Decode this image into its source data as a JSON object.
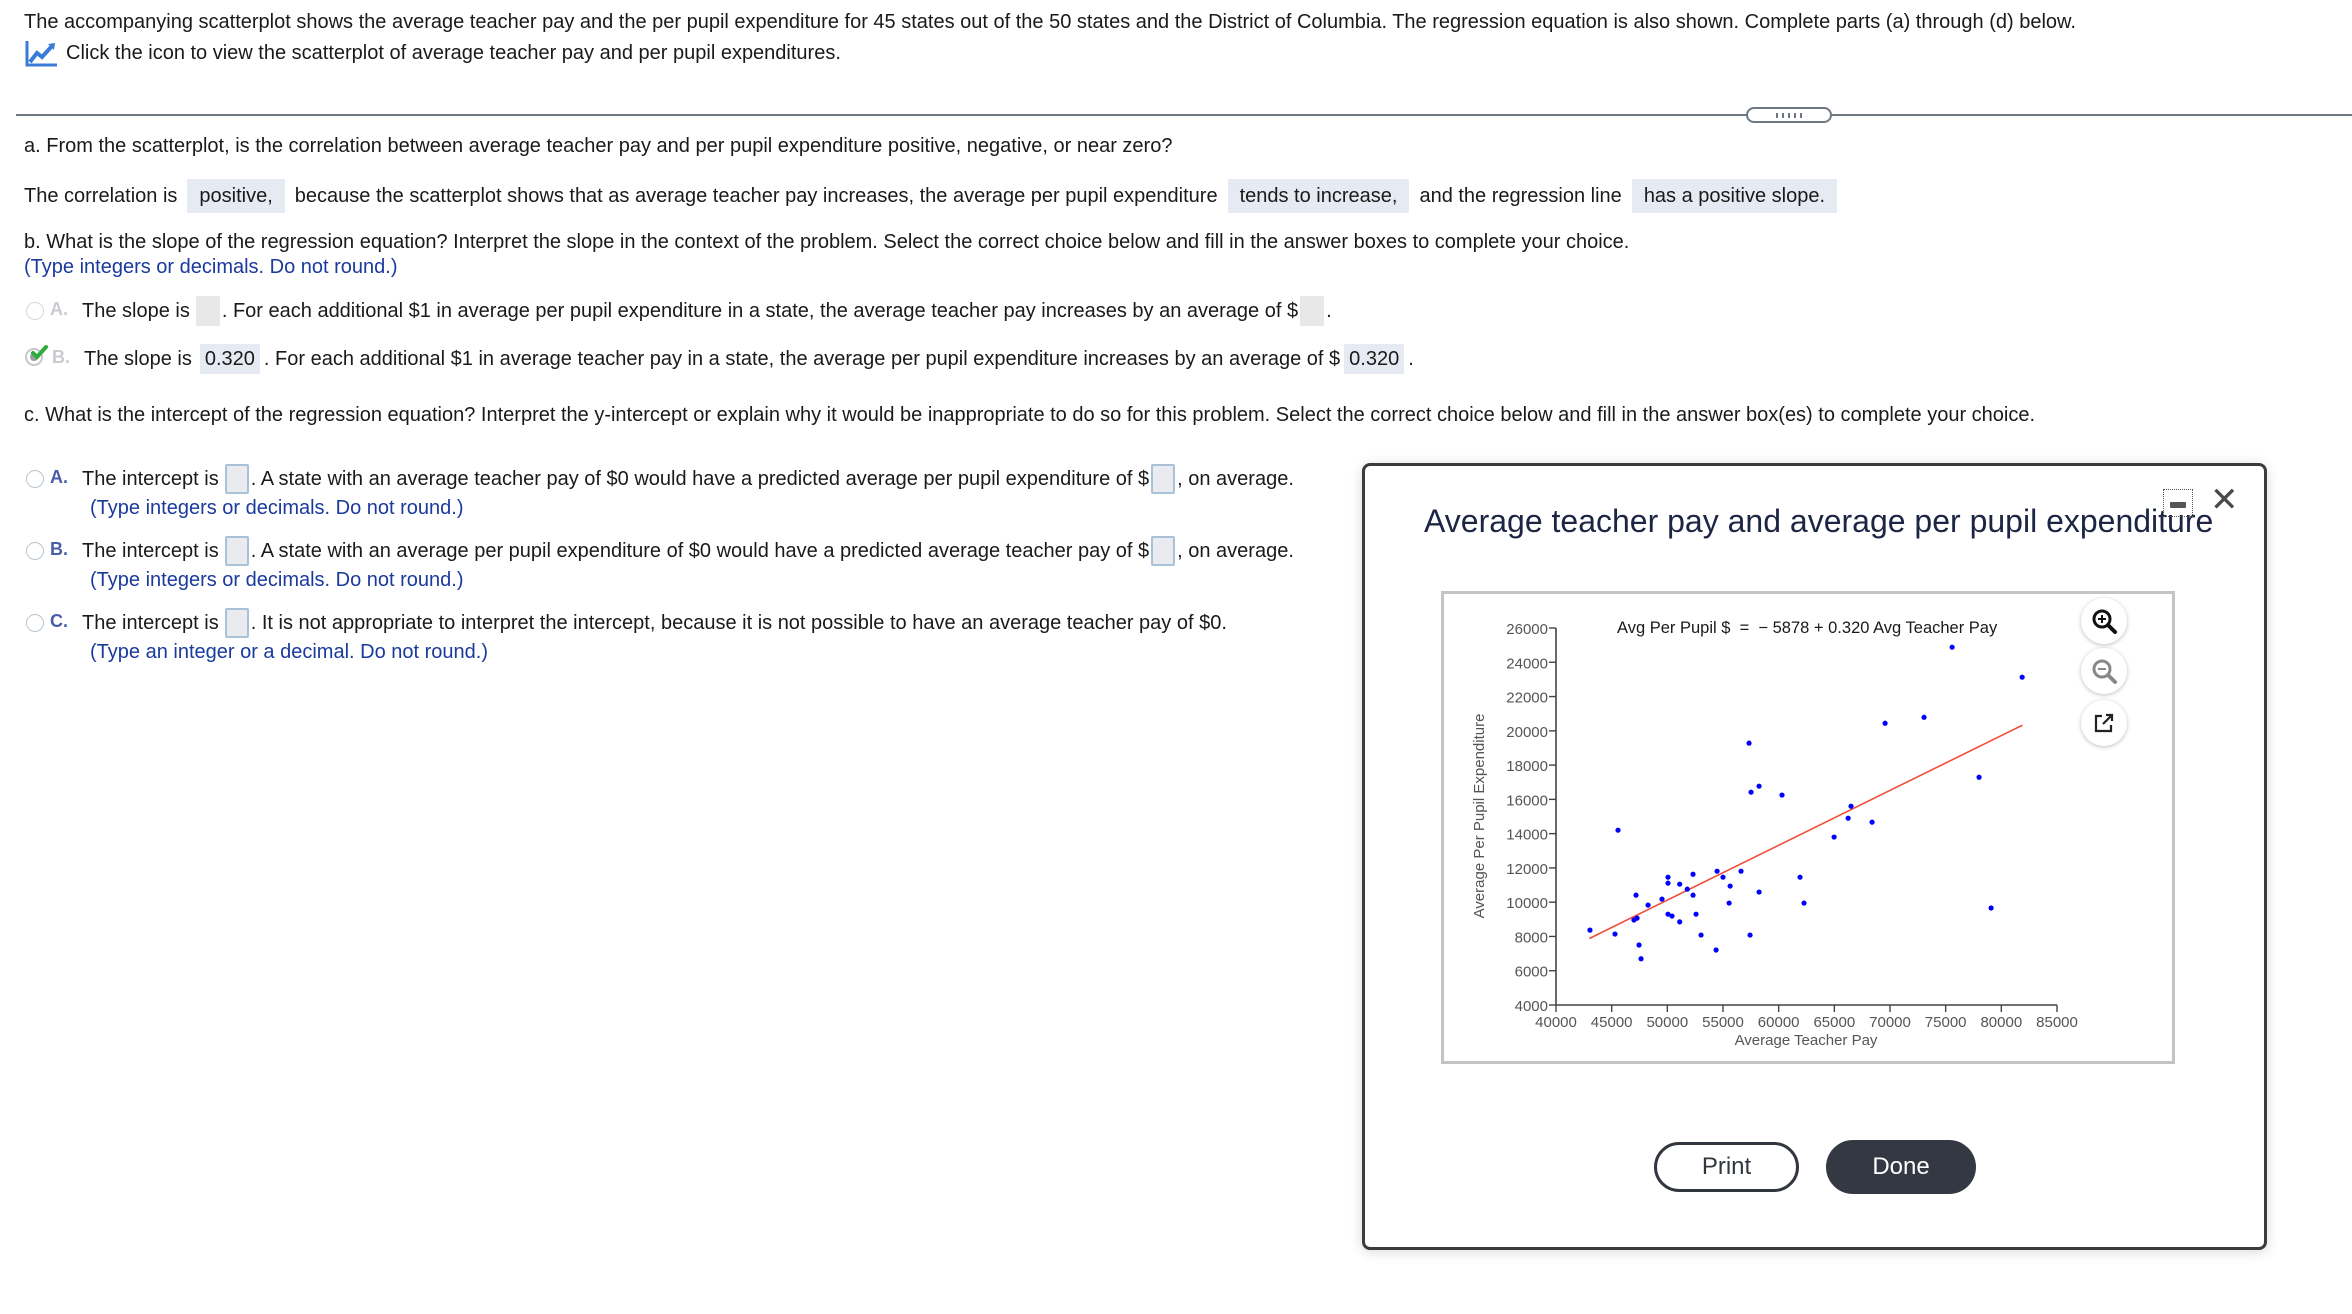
{
  "intro": {
    "text": "The accompanying scatterplot shows the average teacher pay and the per pupil expenditure for 45 states out of the 50 states and the District of Columbia. The regression equation is also shown. Complete parts (a) through (d) below.",
    "link_icon": "chart-line-icon",
    "link_text": "Click the icon to view the scatterplot of average teacher pay and per pupil expenditures."
  },
  "part_a": {
    "question": "a. From the scatterplot, is the correlation between average teacher pay and per pupil expenditure positive, negative, or near zero?",
    "answer_prefix": "The correlation is",
    "answer_1": "positive,",
    "answer_middle": "because the scatterplot shows that as average teacher pay increases, the average per pupil expenditure",
    "answer_2": "tends to increase,",
    "answer_middle_2": "and the regression line",
    "answer_3": "has a positive slope."
  },
  "part_b": {
    "question": "b. What is the slope of the regression equation? Interpret the slope in the context of the problem. Select the correct choice below and fill in the answer boxes to complete your choice.",
    "note": "(Type integers or decimals. Do not round.)",
    "options": [
      {
        "letter": "A.",
        "state": "unselected-disabled",
        "text_1": "The slope is",
        "text_2": ". For each additional $1 in average per pupil expenditure in a state, the average teacher pay increases by an average of $",
        "text_3": ".",
        "value_1": "",
        "value_2": ""
      },
      {
        "letter": "B.",
        "state": "selected-correct",
        "text_1": "The slope is",
        "text_2": ". For each additional $1 in average teacher pay in a state, the average per pupil expenditure increases by an average of $",
        "text_3": ".",
        "value_1": "0.320",
        "value_2": "0.320"
      }
    ]
  },
  "part_c": {
    "question": "c. What is the intercept of the regression equation? Interpret the y-intercept or explain why it would be inappropriate to do so for this problem. Select the correct choice below and fill in the answer box(es) to complete your choice.",
    "options": [
      {
        "letter": "A.",
        "text_1": "The intercept is",
        "text_2": ". A state with an average teacher pay of $0 would have a predicted average per pupil expenditure of $",
        "text_3": ", on average.",
        "note": "(Type integers or decimals. Do not round.)"
      },
      {
        "letter": "B.",
        "text_1": "The intercept is",
        "text_2": ". A state with an average per pupil expenditure of $0 would have a predicted average teacher pay of $",
        "text_3": ", on average.",
        "note": "(Type integers or decimals. Do not round.)"
      },
      {
        "letter": "C.",
        "text_1": "The intercept is",
        "text_2": ". It is not appropriate to interpret the intercept, because it is not possible to have an average teacher pay of $0.",
        "note": "(Type an integer or a decimal. Do not round.)"
      }
    ]
  },
  "modal": {
    "title": "Average teacher pay and average per pupil expenditure",
    "close_icon": "close-icon",
    "minimize_icon": "minimize-icon",
    "tools": [
      "zoom-in-icon",
      "zoom-out-icon",
      "open-external-icon"
    ],
    "print_label": "Print",
    "done_label": "Done"
  },
  "colors": {
    "point": "#0000ff",
    "regression_line": "#f04e37",
    "answer_highlight": "#e6eaf3",
    "note_blue": "#1a3a9c",
    "done_button": "#343843"
  },
  "chart_data": {
    "type": "scatter",
    "title": "Average teacher pay and average per pupil expenditure",
    "annotation": "Avg Per Pupil $  =  − 5878 + 0.320 Avg Teacher Pay",
    "xlabel": "Average Teacher Pay",
    "ylabel": "Average Per Pupil Expenditure",
    "xlim": [
      40000,
      85000
    ],
    "ylim": [
      4000,
      26000
    ],
    "xticks": [
      40000,
      45000,
      50000,
      55000,
      60000,
      65000,
      70000,
      75000,
      80000,
      85000
    ],
    "yticks": [
      4000,
      6000,
      8000,
      10000,
      12000,
      14000,
      16000,
      18000,
      20000,
      22000,
      24000,
      26000
    ],
    "grid": false,
    "regression": {
      "intercept": -5878,
      "slope": 0.32,
      "x_range": [
        43000,
        81900
      ]
    },
    "points": [
      [
        43050,
        8370
      ],
      [
        45570,
        14200
      ],
      [
        45300,
        8140
      ],
      [
        47190,
        10410
      ],
      [
        47000,
        8960
      ],
      [
        47280,
        9070
      ],
      [
        47460,
        7500
      ],
      [
        47640,
        6700
      ],
      [
        48270,
        9830
      ],
      [
        49520,
        10180
      ],
      [
        50060,
        11460
      ],
      [
        50060,
        11110
      ],
      [
        50060,
        9300
      ],
      [
        50420,
        9190
      ],
      [
        51110,
        11050
      ],
      [
        51110,
        8850
      ],
      [
        51790,
        10760
      ],
      [
        52310,
        11630
      ],
      [
        52310,
        10410
      ],
      [
        52580,
        9300
      ],
      [
        53030,
        8080
      ],
      [
        54380,
        7210
      ],
      [
        54470,
        11810
      ],
      [
        55000,
        11460
      ],
      [
        55550,
        9950
      ],
      [
        55640,
        10940
      ],
      [
        56620,
        11810
      ],
      [
        57430,
        8080
      ],
      [
        58240,
        10590
      ],
      [
        61920,
        11460
      ],
      [
        62280,
        9950
      ],
      [
        57340,
        19280
      ],
      [
        57520,
        16420
      ],
      [
        58240,
        16770
      ],
      [
        60300,
        16250
      ],
      [
        64980,
        13800
      ],
      [
        66240,
        14900
      ],
      [
        66500,
        15600
      ],
      [
        68390,
        14670
      ],
      [
        69560,
        20440
      ],
      [
        73060,
        20790
      ],
      [
        75580,
        24880
      ],
      [
        78000,
        17290
      ],
      [
        79080,
        9660
      ],
      [
        81870,
        23130
      ]
    ]
  }
}
